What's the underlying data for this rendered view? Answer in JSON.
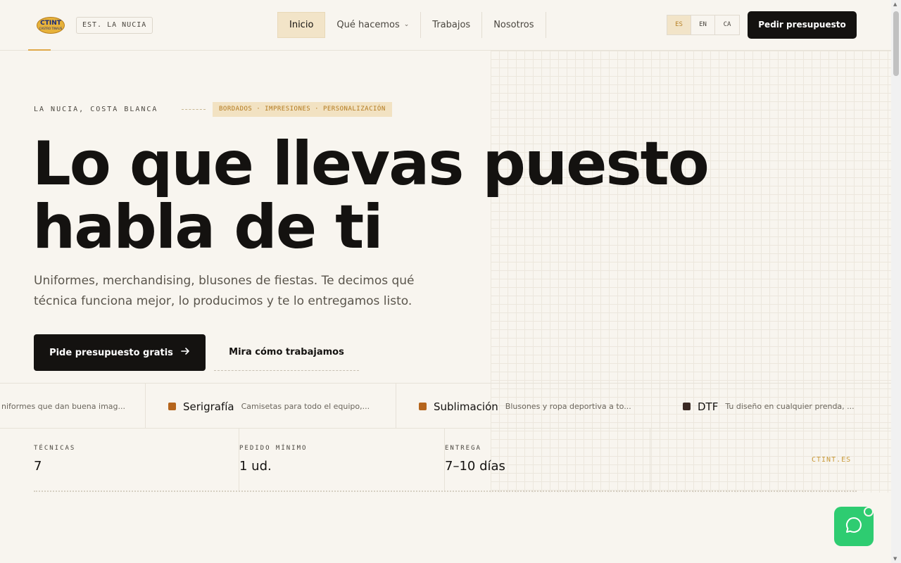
{
  "header": {
    "logo_main": "CTINT",
    "logo_sub": "CASTRO TINAUS",
    "est_badge": "EST. LA NUCIA",
    "nav": [
      {
        "label": "Inicio",
        "active": true
      },
      {
        "label": "Qué hacemos",
        "dropdown": true
      },
      {
        "label": "Trabajos"
      },
      {
        "label": "Nosotros"
      }
    ],
    "languages": [
      "ES",
      "EN",
      "CA"
    ],
    "selected_language": "ES",
    "cta": "Pedir presupuesto"
  },
  "hero": {
    "location": "LA NUCIA, COSTA BLANCA",
    "services_tag": "BORDADOS · IMPRESIONES · PERSONALIZACIÓN",
    "headline_line1": "Lo que llevas puesto",
    "headline_line2": "habla de ti",
    "subtitle": "Uniformes, merchandising, blusones de fiestas. Te decimos qué técnica funciona mejor, lo producimos y te lo entregamos listo.",
    "primary_button": "Pide presupuesto gratis",
    "secondary_button": "Mira cómo trabajamos"
  },
  "marquee": [
    {
      "title": "",
      "desc": "niformes que dan buena imag...",
      "color": ""
    },
    {
      "title": "Serigrafía",
      "desc": "Camisetas para todo el equipo,...",
      "color": "#b5651d"
    },
    {
      "title": "Sublimación",
      "desc": "Blusones y ropa deportiva a to...",
      "color": "#b5651d"
    },
    {
      "title": "DTF",
      "desc": "Tu diseño en cualquier prenda, ...",
      "color": "#3a2a24"
    }
  ],
  "stats": [
    {
      "label": "TÉCNICAS",
      "value": "7"
    },
    {
      "label": "PEDIDO MÍNIMO",
      "value": "1 ud."
    },
    {
      "label": "ENTREGA",
      "value": "7–10 días"
    }
  ],
  "site": "CTINT.ES",
  "colors": {
    "accent": "#e0a94a",
    "dark": "#141210",
    "whatsapp": "#2ecc71",
    "background": "#f8f5ef"
  }
}
